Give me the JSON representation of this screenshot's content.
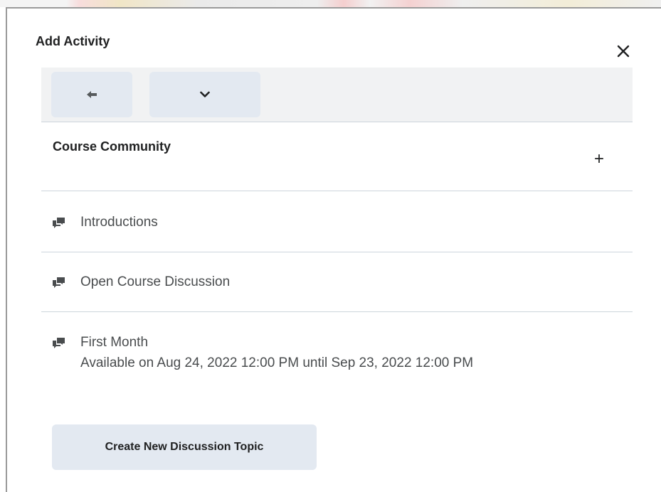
{
  "dialog": {
    "title": "Add Activity",
    "close_icon": "close-icon"
  },
  "toolbar": {
    "back_icon": "arrow-left-icon",
    "more_icon": "chevron-down-icon"
  },
  "section": {
    "title": "Course Community",
    "add_label": "+"
  },
  "items": [
    {
      "name": "Introductions",
      "icon": "discussion-icon"
    },
    {
      "name": "Open Course Discussion",
      "icon": "discussion-icon"
    },
    {
      "name": "First Month",
      "subtitle": "Available on Aug 24, 2022 12:00 PM until Sep 23, 2022 12:00 PM",
      "icon": "discussion-icon"
    }
  ],
  "footer": {
    "create_label": "Create New Discussion Topic"
  },
  "colors": {
    "button_bg": "#e3e9f1",
    "toolbar_bg": "#f1f2f3",
    "divider": "#cdd5dc",
    "text": "#202122",
    "muted_text": "#494c4e"
  }
}
